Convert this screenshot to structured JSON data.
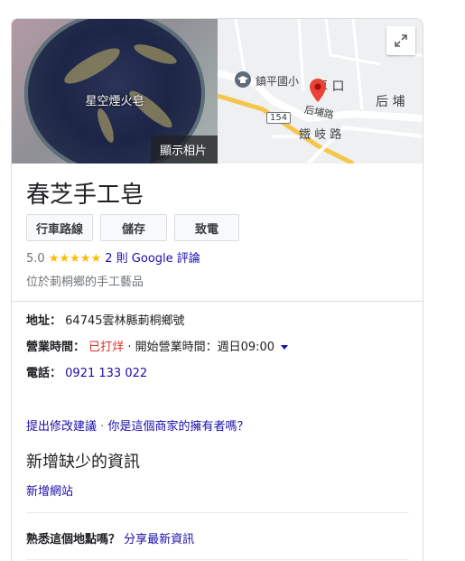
{
  "photo": {
    "caption": "星空煙火皂",
    "show_photos_label": "顯示相片"
  },
  "map": {
    "labels": {
      "school": "鎮平國小",
      "area1": "車 口",
      "area2": "后 埔",
      "road_number": "154",
      "road1": "后埔路",
      "road2": "鐵 岐 路"
    },
    "icons": {
      "expand": "expand-icon",
      "school": "school-icon",
      "pin": "map-pin-icon"
    }
  },
  "business": {
    "name": "春芝手工皂",
    "buttons": {
      "directions": "行車路線",
      "save": "儲存",
      "call": "致電"
    },
    "rating": {
      "score": "5.0",
      "stars": "★★★★★",
      "reviews_text": "2 則 Google 評論"
    },
    "category": "位於莿桐鄉的手工藝品"
  },
  "details": {
    "address_label": "地址：",
    "address_value": "64745雲林縣莿桐鄉號",
    "hours_label": "營業時間：",
    "hours_status": "已打烊",
    "hours_open": "· 開始營業時間：週日09:00",
    "phone_label": "電話：",
    "phone_value": "0921 133 022"
  },
  "links": {
    "suggest_edit": "提出修改建議",
    "owner": "你是這個商家的擁有者嗎？"
  },
  "missing": {
    "heading": "新增缺少的資訊",
    "add_website": "新增網站"
  },
  "familiar": {
    "question": "熟悉這個地點嗎？",
    "share": "分享最新資訊"
  },
  "colors": {
    "link": "#1a0dab",
    "closed": "#d93025",
    "star": "#fbbc04",
    "pin": "#ea4335",
    "road": "#f6c54b"
  }
}
